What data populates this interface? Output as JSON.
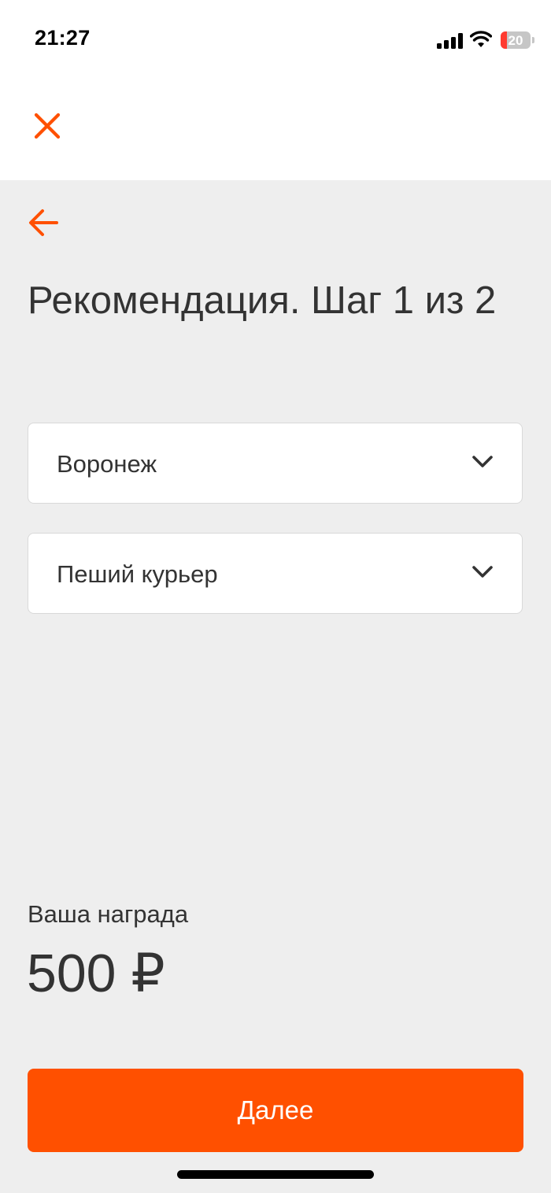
{
  "status_bar": {
    "time": "21:27",
    "battery_text": "20",
    "battery_level": 0.2,
    "icons": [
      "signal-icon",
      "wifi-icon",
      "battery-icon"
    ]
  },
  "header": {
    "close_icon": "close-icon",
    "back_icon": "arrow-left-icon"
  },
  "page": {
    "title": "Рекомендация. Шаг 1 из 2"
  },
  "fields": {
    "city": {
      "value": "Воронеж",
      "icon": "chevron-down-icon"
    },
    "role": {
      "value": "Пеший курьер",
      "icon": "chevron-down-icon"
    }
  },
  "reward": {
    "label": "Ваша награда",
    "amount": "500 ₽"
  },
  "actions": {
    "next_label": "Далее"
  },
  "colors": {
    "accent": "#ff5000",
    "background": "#eeeeee",
    "text": "#333333",
    "battery_low": "#ff3b30"
  }
}
